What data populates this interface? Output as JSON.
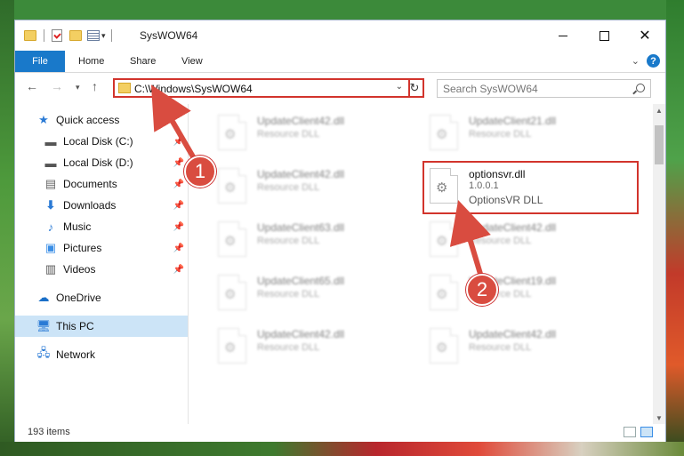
{
  "window": {
    "title": "SysWOW64"
  },
  "ribbon": {
    "tabs": [
      "File",
      "Home",
      "Share",
      "View"
    ],
    "help": "?"
  },
  "nav": {
    "address": "C:\\Windows\\SysWOW64",
    "search_placeholder": "Search SysWOW64"
  },
  "sidebar": {
    "items": [
      {
        "label": "Quick access",
        "icon": "star-icon",
        "pinned": false
      },
      {
        "label": "Local Disk (C:)",
        "icon": "drive-icon",
        "pinned": true
      },
      {
        "label": "Local Disk (D:)",
        "icon": "drive-icon",
        "pinned": true
      },
      {
        "label": "Documents",
        "icon": "documents-icon",
        "pinned": true
      },
      {
        "label": "Downloads",
        "icon": "download-icon",
        "pinned": true
      },
      {
        "label": "Music",
        "icon": "music-icon",
        "pinned": true
      },
      {
        "label": "Pictures",
        "icon": "pictures-icon",
        "pinned": true
      },
      {
        "label": "Videos",
        "icon": "videos-icon",
        "pinned": true
      },
      {
        "label": "OneDrive",
        "icon": "cloud-icon",
        "pinned": false
      },
      {
        "label": "This PC",
        "icon": "computer-icon",
        "pinned": false,
        "selected": true
      },
      {
        "label": "Network",
        "icon": "network-icon",
        "pinned": false
      }
    ]
  },
  "files": [
    {
      "name": "UpdateClient42.dll",
      "desc": "Resource DLL"
    },
    {
      "name": "UpdateClient21.dll",
      "desc": "Resource DLL"
    },
    {
      "name": "UpdateClient42.dll",
      "desc": "Resource DLL"
    },
    {
      "name": "UpdateClient63.dll",
      "desc": "Resource DLL"
    },
    {
      "name": "UpdateClient42.dll",
      "desc": "Resource DLL"
    },
    {
      "name": "UpdateClient65.dll",
      "desc": "Resource DLL"
    },
    {
      "name": "UpdateClient19.dll",
      "desc": "Resource DLL"
    },
    {
      "name": "UpdateClient42.dll",
      "desc": "Resource DLL"
    },
    {
      "name": "UpdateClient42.dll",
      "desc": "Resource DLL"
    }
  ],
  "highlighted_file": {
    "name": "optionsvr.dll",
    "version": "1.0.0.1",
    "company": "OptionsVR DLL"
  },
  "status": {
    "count": "193 items"
  },
  "markers": [
    "1",
    "2"
  ],
  "colors": {
    "accent": "#1979ca",
    "highlight": "#d2342c",
    "marker": "#d94c40",
    "selected": "#cce4f7"
  }
}
